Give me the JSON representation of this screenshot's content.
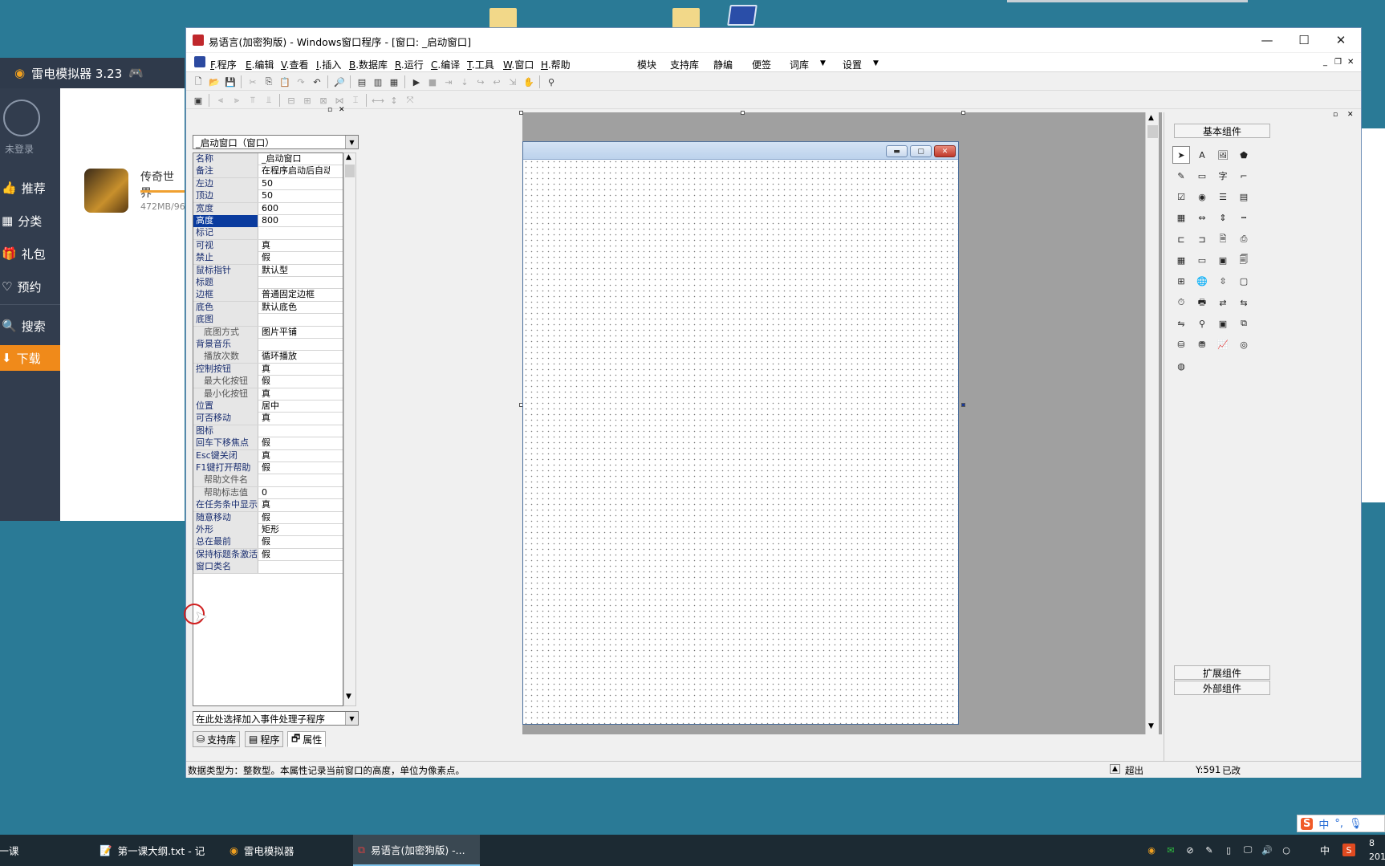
{
  "emulator": {
    "title": "雷电模拟器 3.23",
    "user_label": "未登录",
    "nav": [
      {
        "label": "推荐"
      },
      {
        "label": "分类"
      },
      {
        "label": "礼包"
      },
      {
        "label": "预约"
      },
      {
        "label": "搜索"
      },
      {
        "label": "下载"
      }
    ],
    "game": {
      "name": "传奇世界",
      "size": "472MB/96"
    }
  },
  "window": {
    "title": "易语言(加密狗版) - Windows窗口程序 - [窗口: _启动窗口]",
    "minimize": "—",
    "maximize": "☐",
    "close": "✕"
  },
  "menubar": {
    "items": [
      {
        "key": "F",
        "label": ".程序"
      },
      {
        "key": "E",
        "label": ".编辑"
      },
      {
        "key": "V",
        "label": ".查看"
      },
      {
        "key": "I",
        "label": ".插入"
      },
      {
        "key": "B",
        "label": ".数据库"
      },
      {
        "key": "R",
        "label": ".运行"
      },
      {
        "key": "C",
        "label": ".编译"
      },
      {
        "key": "T",
        "label": ".工具"
      },
      {
        "key": "W",
        "label": ".窗口"
      },
      {
        "key": "H",
        "label": ".帮助"
      }
    ],
    "extra": [
      "模块",
      "支持库",
      "静编",
      "便签",
      "词库",
      "设置"
    ]
  },
  "left_panel": {
    "object_selector": "_启动窗口（窗口）",
    "event_selector": "在此处选择加入事件处理子程序",
    "tabs": [
      "支持库",
      "程序",
      "属性"
    ],
    "properties": [
      {
        "name": "名称",
        "value": "_启动窗口"
      },
      {
        "name": "备注",
        "value": "在程序启动后自动"
      },
      {
        "name": "左边",
        "value": "50"
      },
      {
        "name": "顶边",
        "value": "50"
      },
      {
        "name": "宽度",
        "value": "600"
      },
      {
        "name": "高度",
        "value": "800"
      },
      {
        "name": "标记",
        "value": ""
      },
      {
        "name": "可视",
        "value": "真"
      },
      {
        "name": "禁止",
        "value": "假"
      },
      {
        "name": "鼠标指针",
        "value": "默认型"
      },
      {
        "name": "标题",
        "value": ""
      },
      {
        "name": "边框",
        "value": "普通固定边框"
      },
      {
        "name": "底色",
        "value": "默认底色"
      },
      {
        "name": "底图",
        "value": ""
      },
      {
        "name": "底图方式",
        "value": "图片平铺"
      },
      {
        "name": "背景音乐",
        "value": ""
      },
      {
        "name": "播放次数",
        "value": "循环播放"
      },
      {
        "name": "控制按钮",
        "value": "真"
      },
      {
        "name": "最大化按钮",
        "value": "假"
      },
      {
        "name": "最小化按钮",
        "value": "真"
      },
      {
        "name": "位置",
        "value": "居中"
      },
      {
        "name": "可否移动",
        "value": "真"
      },
      {
        "name": "图标",
        "value": ""
      },
      {
        "name": "回车下移焦点",
        "value": "假"
      },
      {
        "name": "Esc键关闭",
        "value": "真"
      },
      {
        "name": "F1键打开帮助",
        "value": "假"
      },
      {
        "name": "帮助文件名",
        "value": ""
      },
      {
        "name": "帮助标志值",
        "value": "0"
      },
      {
        "name": "在任务条中显示",
        "value": "真"
      },
      {
        "name": "随意移动",
        "value": "假"
      },
      {
        "name": "外形",
        "value": "矩形"
      },
      {
        "name": "总在最前",
        "value": "假"
      },
      {
        "name": "保持标题条激活",
        "value": "假"
      },
      {
        "name": "窗口类名",
        "value": ""
      }
    ]
  },
  "right_panel": {
    "basic_label": "基本组件",
    "extended_label": "扩展组件",
    "external_label": "外部组件",
    "components": [
      "pointer-icon",
      "label-icon",
      "picture-icon",
      "shape-icon",
      "edit-icon",
      "groupbox-icon",
      "text-icon",
      "line-icon",
      "checkbox-icon",
      "radio-icon",
      "list-icon",
      "combo-icon",
      "grid-icon",
      "hscroll-icon",
      "vscroll-icon",
      "ruler-icon",
      "tab-icon",
      "split-icon",
      "file-icon",
      "printer-icon",
      "calendar-icon",
      "button-icon",
      "dir-icon",
      "doc-icon",
      "table-icon",
      "globe-icon",
      "spin-icon",
      "window-icon",
      "clock-icon",
      "print-icon",
      "net-icon",
      "net2-icon",
      "transfer-icon",
      "pipe-icon",
      "frame-icon",
      "tree-icon",
      "db-icon",
      "db2-icon",
      "chart-icon",
      "odbc-icon",
      "odbc2-icon"
    ]
  },
  "statusbar": {
    "message": "数据类型为：整数型。本属性记录当前窗口的高度，单位为像素点。",
    "overflow": "超出",
    "ycoord": "Y:591",
    "modified": "已改"
  },
  "taskbar": {
    "tasks": [
      {
        "label": "第一课"
      },
      {
        "label": "第一课大纲.txt - 记"
      },
      {
        "label": "雷电模拟器"
      },
      {
        "label": "易语言(加密狗版) -..."
      }
    ],
    "ime": "中",
    "time": "8",
    "date": "201"
  }
}
